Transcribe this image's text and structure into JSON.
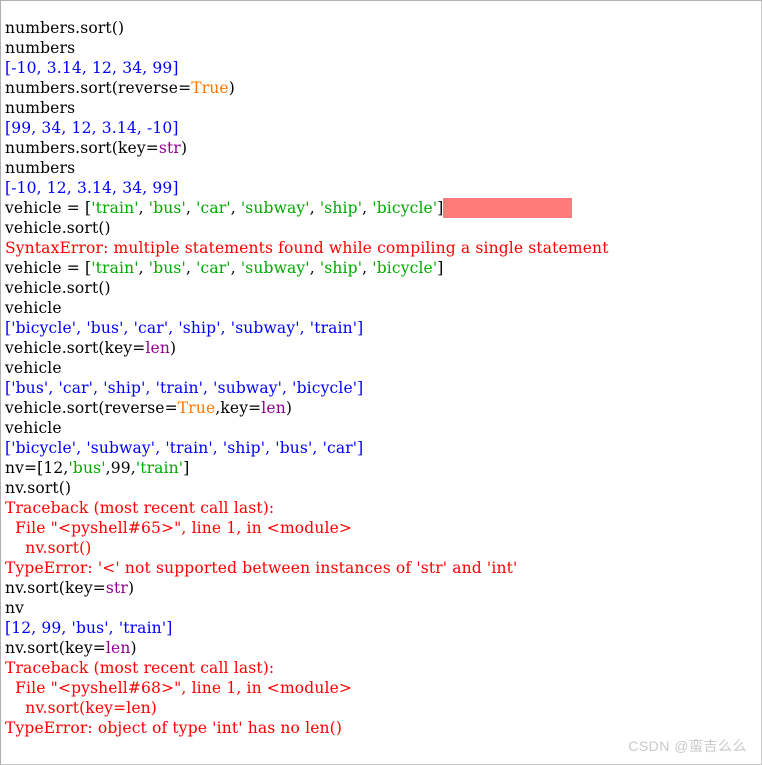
{
  "window": {
    "title": "Python IDLE Shell",
    "background": "#ffffff",
    "border_color": "#b0b0b0"
  },
  "colors": {
    "input_text": "#000000",
    "output_text": "#0000ff",
    "error_text": "#ff0000",
    "keyword": "#ff7700",
    "builtin": "#900090",
    "string": "#00aa00",
    "selection_highlight": "#ff7b7b",
    "watermark": "#c9c9c9"
  },
  "watermark": {
    "text": "CSDN @蛮吉么么"
  },
  "shell": {
    "lines": [
      {
        "id": "l1",
        "kind": "input",
        "tokens": [
          {
            "t": "numbers.sort()",
            "c": "normal"
          }
        ]
      },
      {
        "id": "l2",
        "kind": "input",
        "tokens": [
          {
            "t": "numbers",
            "c": "normal"
          }
        ]
      },
      {
        "id": "l3",
        "kind": "output",
        "tokens": [
          {
            "t": "[-10, 3.14, 12, 34, 99]",
            "c": "output"
          }
        ]
      },
      {
        "id": "l4",
        "kind": "input",
        "tokens": [
          {
            "t": "numbers.sort(reverse=",
            "c": "normal"
          },
          {
            "t": "True",
            "c": "keyword"
          },
          {
            "t": ")",
            "c": "normal"
          }
        ]
      },
      {
        "id": "l5",
        "kind": "input",
        "tokens": [
          {
            "t": "numbers",
            "c": "normal"
          }
        ]
      },
      {
        "id": "l6",
        "kind": "output",
        "tokens": [
          {
            "t": "[99, 34, 12, 3.14, -10]",
            "c": "output"
          }
        ]
      },
      {
        "id": "l7",
        "kind": "input",
        "tokens": [
          {
            "t": "numbers.sort(key=",
            "c": "normal"
          },
          {
            "t": "str",
            "c": "builtin"
          },
          {
            "t": ")",
            "c": "normal"
          }
        ]
      },
      {
        "id": "l8",
        "kind": "input",
        "tokens": [
          {
            "t": "numbers",
            "c": "normal"
          }
        ]
      },
      {
        "id": "l9",
        "kind": "output",
        "tokens": [
          {
            "t": "[-10, 12, 3.14, 34, 99]",
            "c": "output"
          }
        ]
      },
      {
        "id": "l10",
        "kind": "input",
        "highlight": true,
        "tokens": [
          {
            "t": "vehicle = [",
            "c": "normal"
          },
          {
            "t": "'train'",
            "c": "string"
          },
          {
            "t": ", ",
            "c": "normal"
          },
          {
            "t": "'bus'",
            "c": "string"
          },
          {
            "t": ", ",
            "c": "normal"
          },
          {
            "t": "'car'",
            "c": "string"
          },
          {
            "t": ", ",
            "c": "normal"
          },
          {
            "t": "'subway'",
            "c": "string"
          },
          {
            "t": ", ",
            "c": "normal"
          },
          {
            "t": "'ship'",
            "c": "string"
          },
          {
            "t": ", ",
            "c": "normal"
          },
          {
            "t": "'bicycle'",
            "c": "string"
          },
          {
            "t": "]",
            "c": "normal"
          }
        ]
      },
      {
        "id": "l11",
        "kind": "input",
        "tokens": [
          {
            "t": "vehicle.sort()",
            "c": "normal"
          }
        ]
      },
      {
        "id": "l12",
        "kind": "error",
        "tokens": [
          {
            "t": "SyntaxError: multiple statements found while compiling a single statement",
            "c": "error"
          }
        ]
      },
      {
        "id": "l13",
        "kind": "input",
        "tokens": [
          {
            "t": "vehicle = [",
            "c": "normal"
          },
          {
            "t": "'train'",
            "c": "string"
          },
          {
            "t": ", ",
            "c": "normal"
          },
          {
            "t": "'bus'",
            "c": "string"
          },
          {
            "t": ", ",
            "c": "normal"
          },
          {
            "t": "'car'",
            "c": "string"
          },
          {
            "t": ", ",
            "c": "normal"
          },
          {
            "t": "'subway'",
            "c": "string"
          },
          {
            "t": ", ",
            "c": "normal"
          },
          {
            "t": "'ship'",
            "c": "string"
          },
          {
            "t": ", ",
            "c": "normal"
          },
          {
            "t": "'bicycle'",
            "c": "string"
          },
          {
            "t": "]",
            "c": "normal"
          }
        ]
      },
      {
        "id": "l14",
        "kind": "input",
        "tokens": [
          {
            "t": "vehicle.sort()",
            "c": "normal"
          }
        ]
      },
      {
        "id": "l15",
        "kind": "input",
        "tokens": [
          {
            "t": "vehicle",
            "c": "normal"
          }
        ]
      },
      {
        "id": "l16",
        "kind": "output",
        "tokens": [
          {
            "t": "['bicycle', 'bus', 'car', 'ship', 'subway', 'train']",
            "c": "output"
          }
        ]
      },
      {
        "id": "l17",
        "kind": "input",
        "tokens": [
          {
            "t": "vehicle.sort(key=",
            "c": "normal"
          },
          {
            "t": "len",
            "c": "builtin"
          },
          {
            "t": ")",
            "c": "normal"
          }
        ]
      },
      {
        "id": "l18",
        "kind": "input",
        "tokens": [
          {
            "t": "vehicle",
            "c": "normal"
          }
        ]
      },
      {
        "id": "l19",
        "kind": "output",
        "tokens": [
          {
            "t": "['bus', 'car', 'ship', 'train', 'subway', 'bicycle']",
            "c": "output"
          }
        ]
      },
      {
        "id": "l20",
        "kind": "input",
        "tokens": [
          {
            "t": "vehicle.sort(reverse=",
            "c": "normal"
          },
          {
            "t": "True",
            "c": "keyword"
          },
          {
            "t": ",key=",
            "c": "normal"
          },
          {
            "t": "len",
            "c": "builtin"
          },
          {
            "t": ")",
            "c": "normal"
          }
        ]
      },
      {
        "id": "l21",
        "kind": "input",
        "tokens": [
          {
            "t": "vehicle",
            "c": "normal"
          }
        ]
      },
      {
        "id": "l22",
        "kind": "output",
        "tokens": [
          {
            "t": "['bicycle', 'subway', 'train', 'ship', 'bus', 'car']",
            "c": "output"
          }
        ]
      },
      {
        "id": "l23",
        "kind": "input",
        "tokens": [
          {
            "t": "nv=[12,",
            "c": "normal"
          },
          {
            "t": "'bus'",
            "c": "string"
          },
          {
            "t": ",99,",
            "c": "normal"
          },
          {
            "t": "'train'",
            "c": "string"
          },
          {
            "t": "]",
            "c": "normal"
          }
        ]
      },
      {
        "id": "l24",
        "kind": "input",
        "tokens": [
          {
            "t": "nv.sort()",
            "c": "normal"
          }
        ]
      },
      {
        "id": "l25",
        "kind": "error",
        "tokens": [
          {
            "t": "Traceback (most recent call last):",
            "c": "error"
          }
        ]
      },
      {
        "id": "l26",
        "kind": "error",
        "tokens": [
          {
            "t": "  File \"<pyshell#65>\", line 1, in <module>",
            "c": "error"
          }
        ]
      },
      {
        "id": "l27",
        "kind": "error",
        "tokens": [
          {
            "t": "    nv.sort()",
            "c": "error"
          }
        ]
      },
      {
        "id": "l28",
        "kind": "error",
        "tokens": [
          {
            "t": "TypeError: '<' not supported between instances of 'str' and 'int'",
            "c": "error"
          }
        ]
      },
      {
        "id": "l29",
        "kind": "input",
        "tokens": [
          {
            "t": "nv.sort(key=",
            "c": "normal"
          },
          {
            "t": "str",
            "c": "builtin"
          },
          {
            "t": ")",
            "c": "normal"
          }
        ]
      },
      {
        "id": "l30",
        "kind": "input",
        "tokens": [
          {
            "t": "nv",
            "c": "normal"
          }
        ]
      },
      {
        "id": "l31",
        "kind": "output",
        "tokens": [
          {
            "t": "[12, 99, 'bus', 'train']",
            "c": "output"
          }
        ]
      },
      {
        "id": "l32",
        "kind": "input",
        "tokens": [
          {
            "t": "nv.sort(key=",
            "c": "normal"
          },
          {
            "t": "len",
            "c": "builtin"
          },
          {
            "t": ")",
            "c": "normal"
          }
        ]
      },
      {
        "id": "l33",
        "kind": "error",
        "tokens": [
          {
            "t": "Traceback (most recent call last):",
            "c": "error"
          }
        ]
      },
      {
        "id": "l34",
        "kind": "error",
        "tokens": [
          {
            "t": "  File \"<pyshell#68>\", line 1, in <module>",
            "c": "error"
          }
        ]
      },
      {
        "id": "l35",
        "kind": "error",
        "tokens": [
          {
            "t": "    nv.sort(key=len)",
            "c": "error"
          }
        ]
      },
      {
        "id": "l36",
        "kind": "error",
        "tokens": [
          {
            "t": "TypeError: object of type 'int' has no len()",
            "c": "error"
          }
        ]
      }
    ]
  }
}
